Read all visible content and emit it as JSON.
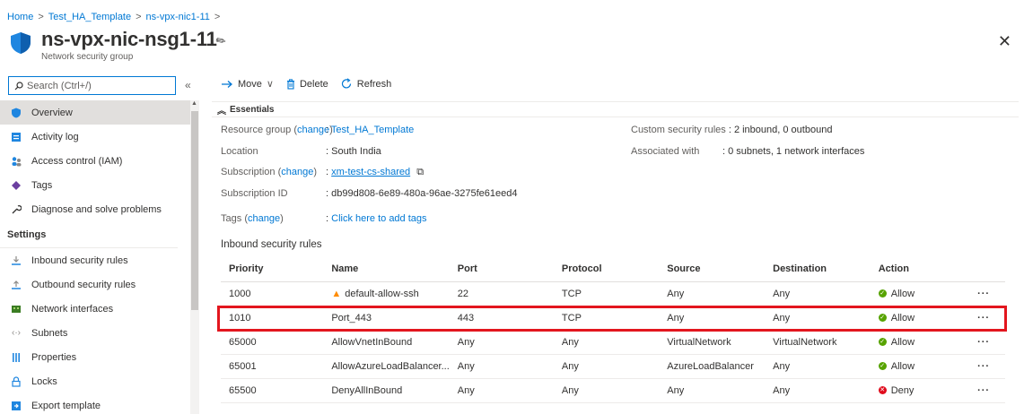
{
  "breadcrumb": [
    "Home",
    "Test_HA_Template",
    "ns-vpx-nic1-11"
  ],
  "header": {
    "title": "ns-vpx-nic-nsg1-11",
    "subtitle": "Network security group"
  },
  "search": {
    "placeholder": "Search (Ctrl+/)"
  },
  "sidebar": {
    "items": [
      {
        "label": "Overview",
        "icon": "shield-icon",
        "active": true
      },
      {
        "label": "Activity log",
        "icon": "log-icon"
      },
      {
        "label": "Access control (IAM)",
        "icon": "people-icon"
      },
      {
        "label": "Tags",
        "icon": "tag-icon"
      },
      {
        "label": "Diagnose and solve problems",
        "icon": "wrench-icon"
      }
    ],
    "settings_header": "Settings",
    "settings_items": [
      {
        "label": "Inbound security rules",
        "icon": "inbound-icon"
      },
      {
        "label": "Outbound security rules",
        "icon": "outbound-icon"
      },
      {
        "label": "Network interfaces",
        "icon": "nic-icon"
      },
      {
        "label": "Subnets",
        "icon": "subnet-icon"
      },
      {
        "label": "Properties",
        "icon": "properties-icon"
      },
      {
        "label": "Locks",
        "icon": "lock-icon"
      },
      {
        "label": "Export template",
        "icon": "export-icon"
      }
    ]
  },
  "toolbar": {
    "move": "Move",
    "delete": "Delete",
    "refresh": "Refresh"
  },
  "essentials": {
    "header": "Essentials",
    "resource_group_label": "Resource group",
    "change": "change",
    "resource_group_value": "Test_HA_Template",
    "location_label": "Location",
    "location_value": ": South India",
    "subscription_label": "Subscription",
    "subscription_value": "xm-test-cs-shared",
    "subscription_id_label": "Subscription ID",
    "subscription_id_value": ": db99d808-6e89-480a-96ae-3275fe61eed4",
    "tags_label": "Tags",
    "tags_value": "Click here to add tags",
    "custom_rules_label": "Custom security rules",
    "custom_rules_value": ": 2 inbound, 0 outbound",
    "associated_label": "Associated with",
    "associated_value": ": 0 subnets, 1 network interfaces"
  },
  "inbound": {
    "title": "Inbound security rules",
    "columns": [
      "Priority",
      "Name",
      "Port",
      "Protocol",
      "Source",
      "Destination",
      "Action"
    ],
    "rows": [
      {
        "priority": "1000",
        "name": "default-allow-ssh",
        "port": "22",
        "protocol": "TCP",
        "source": "Any",
        "destination": "Any",
        "action": "Allow",
        "warning": true
      },
      {
        "priority": "1010",
        "name": "Port_443",
        "port": "443",
        "protocol": "TCP",
        "source": "Any",
        "destination": "Any",
        "action": "Allow"
      },
      {
        "priority": "65000",
        "name": "AllowVnetInBound",
        "port": "Any",
        "protocol": "Any",
        "source": "VirtualNetwork",
        "destination": "VirtualNetwork",
        "action": "Allow"
      },
      {
        "priority": "65001",
        "name": "AllowAzureLoadBalancer...",
        "port": "Any",
        "protocol": "Any",
        "source": "AzureLoadBalancer",
        "destination": "Any",
        "action": "Allow"
      },
      {
        "priority": "65500",
        "name": "DenyAllInBound",
        "port": "Any",
        "protocol": "Any",
        "source": "Any",
        "destination": "Any",
        "action": "Deny"
      }
    ]
  },
  "colors": {
    "link": "#0078d4",
    "highlight": "#e3161e",
    "allow": "#57a300",
    "deny": "#e00b1c"
  }
}
